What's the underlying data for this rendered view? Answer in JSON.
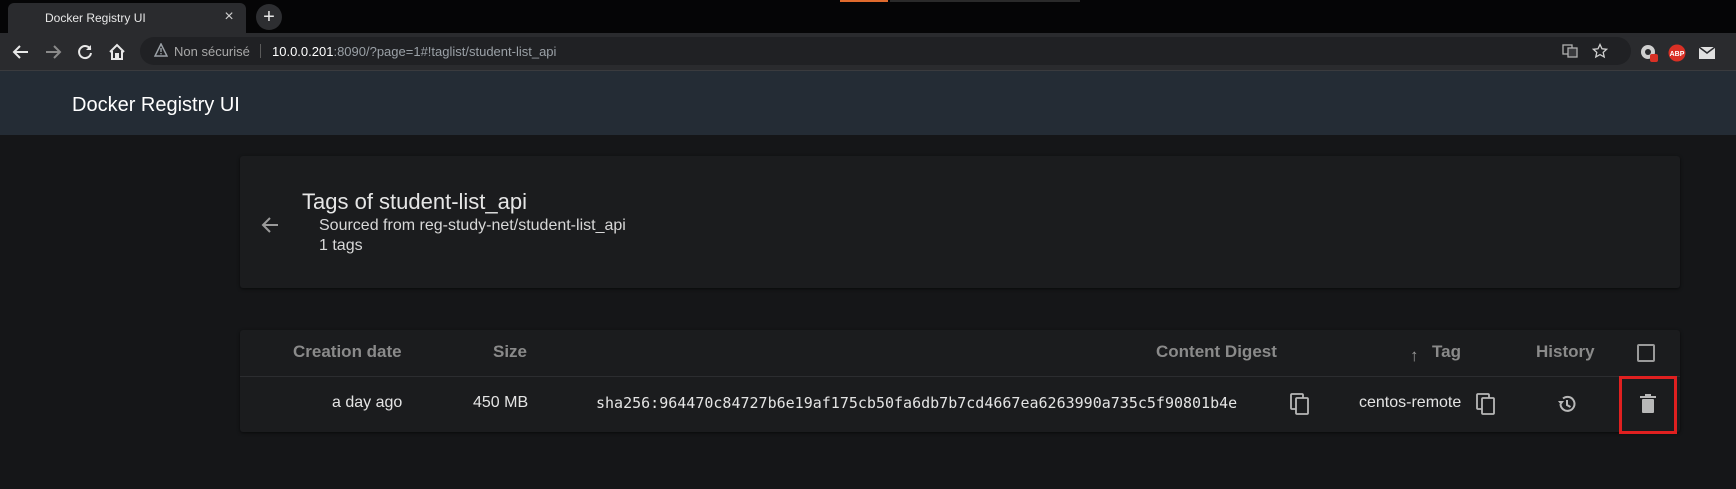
{
  "browser": {
    "tab_title": "Docker Registry UI",
    "new_tab_symbol": "+",
    "close_symbol": "×",
    "security_label": "Non sécurisé",
    "url_host": "10.0.0.201",
    "url_rest": ":8090/?page=1#!taglist/student-list_api",
    "extension_badge": "1",
    "abp_label": "ABP"
  },
  "app": {
    "title": "Docker Registry UI"
  },
  "taglist": {
    "title": "Tags of student-list_api",
    "source": "Sourced from reg-study-net/student-list_api",
    "count": "1 tags"
  },
  "table": {
    "columns": {
      "creation_date": "Creation date",
      "size": "Size",
      "content_digest": "Content Digest",
      "tag": "Tag",
      "history": "History"
    },
    "sort_indicator": "↑",
    "rows": [
      {
        "creation_date": "a day ago",
        "size": "450 MB",
        "digest": "sha256:964470c84727b6e19af175cb50fa6db7b7cd4667ea6263990a735c5f90801b4e",
        "tag": "centos-remote"
      }
    ]
  },
  "colors": {
    "appbar": "#242c35",
    "background": "#151618",
    "highlight": "#e02020"
  },
  "icons": [
    "back-arrow-icon",
    "forward-arrow-icon",
    "reload-icon",
    "home-icon",
    "warning-icon",
    "translate-icon",
    "star-icon",
    "copy-icon",
    "history-icon",
    "trash-icon"
  ]
}
